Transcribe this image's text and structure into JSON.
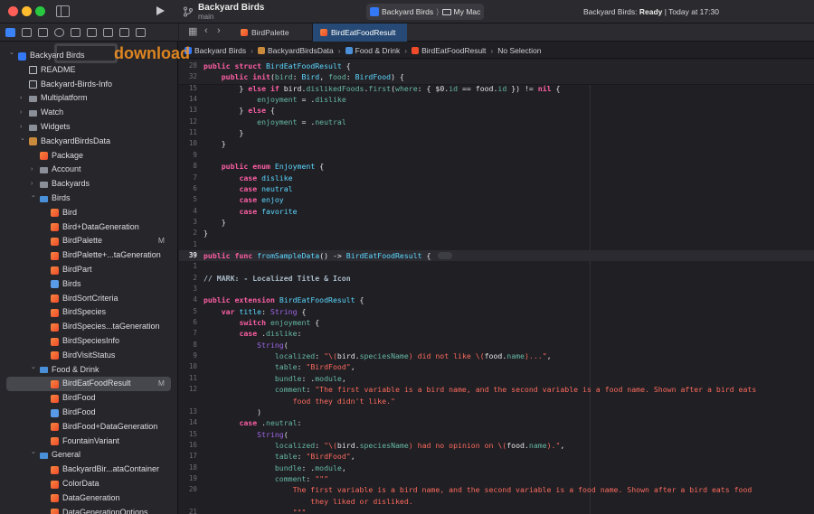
{
  "title_bar": {
    "project_title": "Backyard Birds",
    "branch": "main",
    "scheme_app": "Backyard Birds",
    "scheme_separator": "⟩",
    "scheme_destination": "My Mac",
    "status_prefix": "Backyard Birds: ",
    "status_state": "Ready",
    "status_suffix": " | Today at 17:30"
  },
  "watermark": {
    "text": "download"
  },
  "sidebar": {
    "items": [
      {
        "label": "Backyard Birds",
        "icon": "app-icon",
        "depth": 0,
        "chevron": "open"
      },
      {
        "label": "README",
        "icon": "doc-icon",
        "depth": 1,
        "chevron": ""
      },
      {
        "label": "Backyard-Birds-Info",
        "icon": "doc-icon",
        "depth": 1,
        "chevron": ""
      },
      {
        "label": "Multiplatform",
        "icon": "folder-icon",
        "depth": 1,
        "chevron": "closed"
      },
      {
        "label": "Watch",
        "icon": "folder-icon",
        "depth": 1,
        "chevron": "closed"
      },
      {
        "label": "Widgets",
        "icon": "folder-icon",
        "depth": 1,
        "chevron": "closed"
      },
      {
        "label": "BackyardBirdsData",
        "icon": "package-icon",
        "depth": 1,
        "chevron": "open"
      },
      {
        "label": "Package",
        "icon": "swift-file-icon",
        "depth": 2,
        "chevron": ""
      },
      {
        "label": "Account",
        "icon": "folder-icon",
        "depth": 2,
        "chevron": "closed"
      },
      {
        "label": "Backyards",
        "icon": "folder-icon",
        "depth": 2,
        "chevron": "closed"
      },
      {
        "label": "Birds",
        "icon": "folder-blue-icon",
        "depth": 2,
        "chevron": "open"
      },
      {
        "label": "Bird",
        "icon": "swift-file-icon",
        "depth": 3,
        "chevron": ""
      },
      {
        "label": "Bird+DataGeneration",
        "icon": "swift-file-icon",
        "depth": 3,
        "chevron": ""
      },
      {
        "label": "BirdPalette",
        "icon": "swift-file-icon",
        "depth": 3,
        "chevron": "",
        "badge": "M"
      },
      {
        "label": "BirdPalette+...taGeneration",
        "icon": "swift-file-icon",
        "depth": 3,
        "chevron": ""
      },
      {
        "label": "BirdPart",
        "icon": "swift-file-icon",
        "depth": 3,
        "chevron": ""
      },
      {
        "label": "Birds",
        "icon": "asset-catalog-icon",
        "depth": 3,
        "chevron": ""
      },
      {
        "label": "BirdSortCriteria",
        "icon": "swift-file-icon",
        "depth": 3,
        "chevron": ""
      },
      {
        "label": "BirdSpecies",
        "icon": "swift-file-icon",
        "depth": 3,
        "chevron": ""
      },
      {
        "label": "BirdSpecies...taGeneration",
        "icon": "swift-file-icon",
        "depth": 3,
        "chevron": ""
      },
      {
        "label": "BirdSpeciesInfo",
        "icon": "swift-file-icon",
        "depth": 3,
        "chevron": ""
      },
      {
        "label": "BirdVisitStatus",
        "icon": "swift-file-icon",
        "depth": 3,
        "chevron": ""
      },
      {
        "label": "Food & Drink",
        "icon": "folder-blue-icon",
        "depth": 2,
        "chevron": "open"
      },
      {
        "label": "BirdEatFoodResult",
        "icon": "swift-file-icon",
        "depth": 3,
        "chevron": "",
        "badge": "M",
        "selected": true
      },
      {
        "label": "BirdFood",
        "icon": "swift-file-icon",
        "depth": 3,
        "chevron": ""
      },
      {
        "label": "BirdFood",
        "icon": "asset-catalog-icon",
        "depth": 3,
        "chevron": ""
      },
      {
        "label": "BirdFood+DataGeneration",
        "icon": "swift-file-icon",
        "depth": 3,
        "chevron": ""
      },
      {
        "label": "FountainVariant",
        "icon": "swift-file-icon",
        "depth": 3,
        "chevron": ""
      },
      {
        "label": "General",
        "icon": "folder-blue-icon",
        "depth": 2,
        "chevron": "open"
      },
      {
        "label": "BackyardBir...ataContainer",
        "icon": "swift-file-icon",
        "depth": 3,
        "chevron": ""
      },
      {
        "label": "ColorData",
        "icon": "swift-file-icon",
        "depth": 3,
        "chevron": ""
      },
      {
        "label": "DataGeneration",
        "icon": "swift-file-icon",
        "depth": 3,
        "chevron": ""
      },
      {
        "label": "DataGenerationOptions",
        "icon": "swift-file-icon",
        "depth": 3,
        "chevron": ""
      }
    ]
  },
  "tabs": [
    {
      "label": "BirdPalette",
      "active": false
    },
    {
      "label": "BirdEatFoodResult",
      "active": true
    }
  ],
  "breadcrumb": [
    {
      "label": "Backyard Birds"
    },
    {
      "label": "BackyardBirdsData"
    },
    {
      "label": "Food & Drink"
    },
    {
      "label": "BirdEatFoodResult"
    },
    {
      "label": "No Selection"
    }
  ],
  "editor": {
    "lines": [
      {
        "n": "28",
        "html": "<span class=\"k\">public struct</span> <span class=\"t\">BirdEatFoodResult</span> {",
        "sticky": true
      },
      {
        "n": "32",
        "html": "    <span class=\"k\">public</span> <span class=\"k\">init</span>(<span class=\"f\">bird</span>: <span class=\"t\">Bird</span>, <span class=\"f\">food</span>: <span class=\"t\">BirdFood</span>) {",
        "sticky": true
      },
      {
        "n": "15",
        "html": "        } <span class=\"k\">else if</span> bird.<span class=\"f\">dislikedFoods</span>.<span class=\"f\">first</span>(<span class=\"f\">where</span>: { $0.<span class=\"f\">id</span> == food.<span class=\"f\">id</span> }) != <span class=\"k\">nil</span> {"
      },
      {
        "n": "14",
        "html": "            <span class=\"f\">enjoyment</span> = .<span class=\"f\">dislike</span>"
      },
      {
        "n": "13",
        "html": "        } <span class=\"k\">else</span> {"
      },
      {
        "n": "12",
        "html": "            <span class=\"f\">enjoyment</span> = .<span class=\"f\">neutral</span>"
      },
      {
        "n": "11",
        "html": "        }"
      },
      {
        "n": "10",
        "html": "    }"
      },
      {
        "n": "9",
        "html": ""
      },
      {
        "n": "8",
        "html": "    <span class=\"k\">public enum</span> <span class=\"t\">Enjoyment</span> {"
      },
      {
        "n": "7",
        "html": "        <span class=\"k\">case</span> <span class=\"t\">dislike</span>"
      },
      {
        "n": "6",
        "html": "        <span class=\"k\">case</span> <span class=\"t\">neutral</span>"
      },
      {
        "n": "5",
        "html": "        <span class=\"k\">case</span> <span class=\"t\">enjoy</span>"
      },
      {
        "n": "4",
        "html": "        <span class=\"k\">case</span> <span class=\"t\">favorite</span>"
      },
      {
        "n": "3",
        "html": "    }"
      },
      {
        "n": "2",
        "html": "}"
      },
      {
        "n": "1",
        "html": ""
      },
      {
        "n": "39",
        "html": "<span class=\"k\">public func</span> <span class=\"t\">fromSampleData</span>() -> <span class=\"t\">BirdEatFoodResult</span> { <span class=\"code-pill\"></span>",
        "current": true
      },
      {
        "n": "1",
        "html": ""
      },
      {
        "n": "2",
        "html": "<span class=\"mark\">// MARK: - Localized Title &amp; Icon</span>"
      },
      {
        "n": "3",
        "html": ""
      },
      {
        "n": "4",
        "html": "<span class=\"k\">public extension</span> <span class=\"t\">BirdEatFoodResult</span> {"
      },
      {
        "n": "5",
        "html": "    <span class=\"k\">var</span> <span class=\"t\">title</span>: <span class=\"p\">String</span> {"
      },
      {
        "n": "6",
        "html": "        <span class=\"k\">switch</span> <span class=\"f\">enjoyment</span> {"
      },
      {
        "n": "7",
        "html": "        <span class=\"k\">case</span> .<span class=\"f\">dislike</span>:"
      },
      {
        "n": "8",
        "html": "            <span class=\"p\">String</span>("
      },
      {
        "n": "9",
        "html": "                <span class=\"f\">localized</span>: <span class=\"s\">\"\\(</span>bird.<span class=\"f\">speciesName</span><span class=\"s\">) did not like \\(</span>food.<span class=\"f\">name</span><span class=\"s\">)...\"</span>,"
      },
      {
        "n": "10",
        "html": "                <span class=\"f\">table</span>: <span class=\"s\">\"BirdFood\"</span>,"
      },
      {
        "n": "11",
        "html": "                <span class=\"f\">bundle</span>: .<span class=\"f\">module</span>,"
      },
      {
        "n": "12",
        "html": "                <span class=\"f\">comment</span>: <span class=\"s\">\"The first variable is a bird name, and the second variable is a food name. Shown after a bird eats</span>"
      },
      {
        "n": "",
        "html": "<span class=\"s\">                    food they didn't like.\"</span>"
      },
      {
        "n": "13",
        "html": "            )"
      },
      {
        "n": "14",
        "html": "        <span class=\"k\">case</span> .<span class=\"f\">neutral</span>:"
      },
      {
        "n": "15",
        "html": "            <span class=\"p\">String</span>("
      },
      {
        "n": "16",
        "html": "                <span class=\"f\">localized</span>: <span class=\"s\">\"\\(</span>bird.<span class=\"f\">speciesName</span><span class=\"s\">) had no opinion on \\(</span>food.<span class=\"f\">name</span><span class=\"s\">).\"</span>,"
      },
      {
        "n": "17",
        "html": "                <span class=\"f\">table</span>: <span class=\"s\">\"BirdFood\"</span>,"
      },
      {
        "n": "18",
        "html": "                <span class=\"f\">bundle</span>: .<span class=\"f\">module</span>,"
      },
      {
        "n": "19",
        "html": "                <span class=\"f\">comment</span>: <span class=\"s\">\"\"\"</span>"
      },
      {
        "n": "20",
        "html": "<span class=\"s\">                    The first variable is a bird name, and the second variable is a food name. Shown after a bird eats food</span>"
      },
      {
        "n": "",
        "html": "<span class=\"s\">                        they liked or disliked.</span>"
      },
      {
        "n": "21",
        "html": "<span class=\"s\">                    \"\"\"</span>"
      }
    ]
  }
}
